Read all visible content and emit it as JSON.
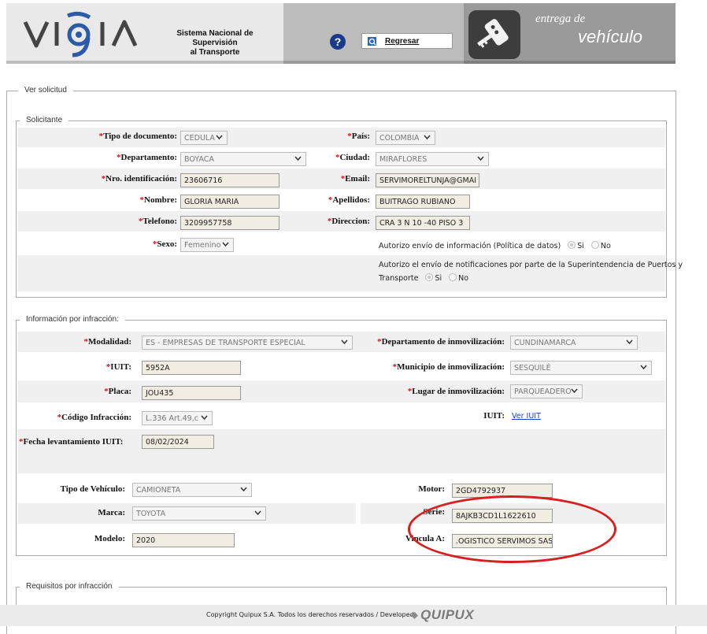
{
  "header": {
    "system_title_line1": "Sistema Nacional de",
    "system_title_line2": "Supervisión",
    "system_title_line3": "al Transporte",
    "back_label": "Regresar",
    "entrega_label": "entrega de",
    "vehiculo_label": "vehículo"
  },
  "main": {
    "legend": "Ver solicitud",
    "solicitante": {
      "legend": "Solicitante",
      "tipo_doc_label": "Tipo de documento:",
      "tipo_doc_value": "CEDULA",
      "pais_label": "País:",
      "pais_value": "COLOMBIA",
      "departamento_label": "Departamento:",
      "departamento_value": "BOYACA",
      "ciudad_label": "Ciudad:",
      "ciudad_value": "MIRAFLORES",
      "nro_id_label": "Nro. identificación:",
      "nro_id_value": "23606716",
      "email_label": "Email:",
      "email_value": "SERVIMORELTUNJA@GMAI",
      "nombre_label": "Nombre:",
      "nombre_value": "GLORIA MARIA",
      "apellidos_label": "Apellidos:",
      "apellidos_value": "BUITRAGO RUBIANO",
      "telefono_label": "Telefono:",
      "telefono_value": "3209957758",
      "direccion_label": "Direccion:",
      "direccion_value": "CRA 3 N 10 -40 PISO 3",
      "sexo_label": "Sexo:",
      "sexo_value": "Femenino",
      "autorizo_datos": "Autorizo envío de información (Política de datos)",
      "autorizo_notif_line1": "Autorizo el envío de notificaciones por parte de la Superintendencia de Puertos y",
      "autorizo_notif_line2": "Transporte",
      "si_label": "Si",
      "no_label": "No"
    },
    "infraccion": {
      "legend": "Información por infracción:",
      "modalidad_label": "Modalidad:",
      "modalidad_value": "ES - EMPRESAS DE TRANSPORTE ESPECIAL",
      "depto_inmov_label": "Departamento de inmovilización:",
      "depto_inmov_value": "CUNDINAMARCA",
      "iuit_label": "IUIT:",
      "iuit_value": "5952A",
      "municipio_label": "Municipio de inmovilización:",
      "municipio_value": "SESQUILÉ",
      "placa_label": "Placa:",
      "placa_value": "JOU435",
      "lugar_label": "Lugar de inmovilización:",
      "lugar_value": "PARQUEADERO",
      "codigo_label": "Código Infracción:",
      "codigo_value": "L.336 Art.49,c",
      "iuit2_label": "IUIT:",
      "ver_iuit": "Ver IUIT",
      "fecha_label": "Fecha levantamiento IUIT:",
      "fecha_value": "08/02/2024",
      "tipo_vehiculo_label": "Tipo de Vehículo:",
      "tipo_vehiculo_value": "CAMIONETA",
      "motor_label": "Motor:",
      "motor_value": "2GD4792937",
      "marca_label": "Marca:",
      "marca_value": "TOYOTA",
      "serie_label": "Serie:",
      "serie_value": "8AJKB3CD1L1622610",
      "modelo_label": "Modelo:",
      "modelo_value": "2020",
      "vincula_label": "Vincula A:",
      "vincula_value": ".OGISTICO SERVIMOS SAS"
    },
    "requisitos": {
      "legend": "Requisitos por infracción"
    }
  },
  "footer": {
    "copyright": "Copyright Quipux S.A. Todos los derechos reservados / Developed",
    "brand": "QUIPUX"
  },
  "colors": {
    "required_star": "#e01010",
    "annotation_ellipse": "#d81e1e",
    "link": "#1a3fd0"
  }
}
